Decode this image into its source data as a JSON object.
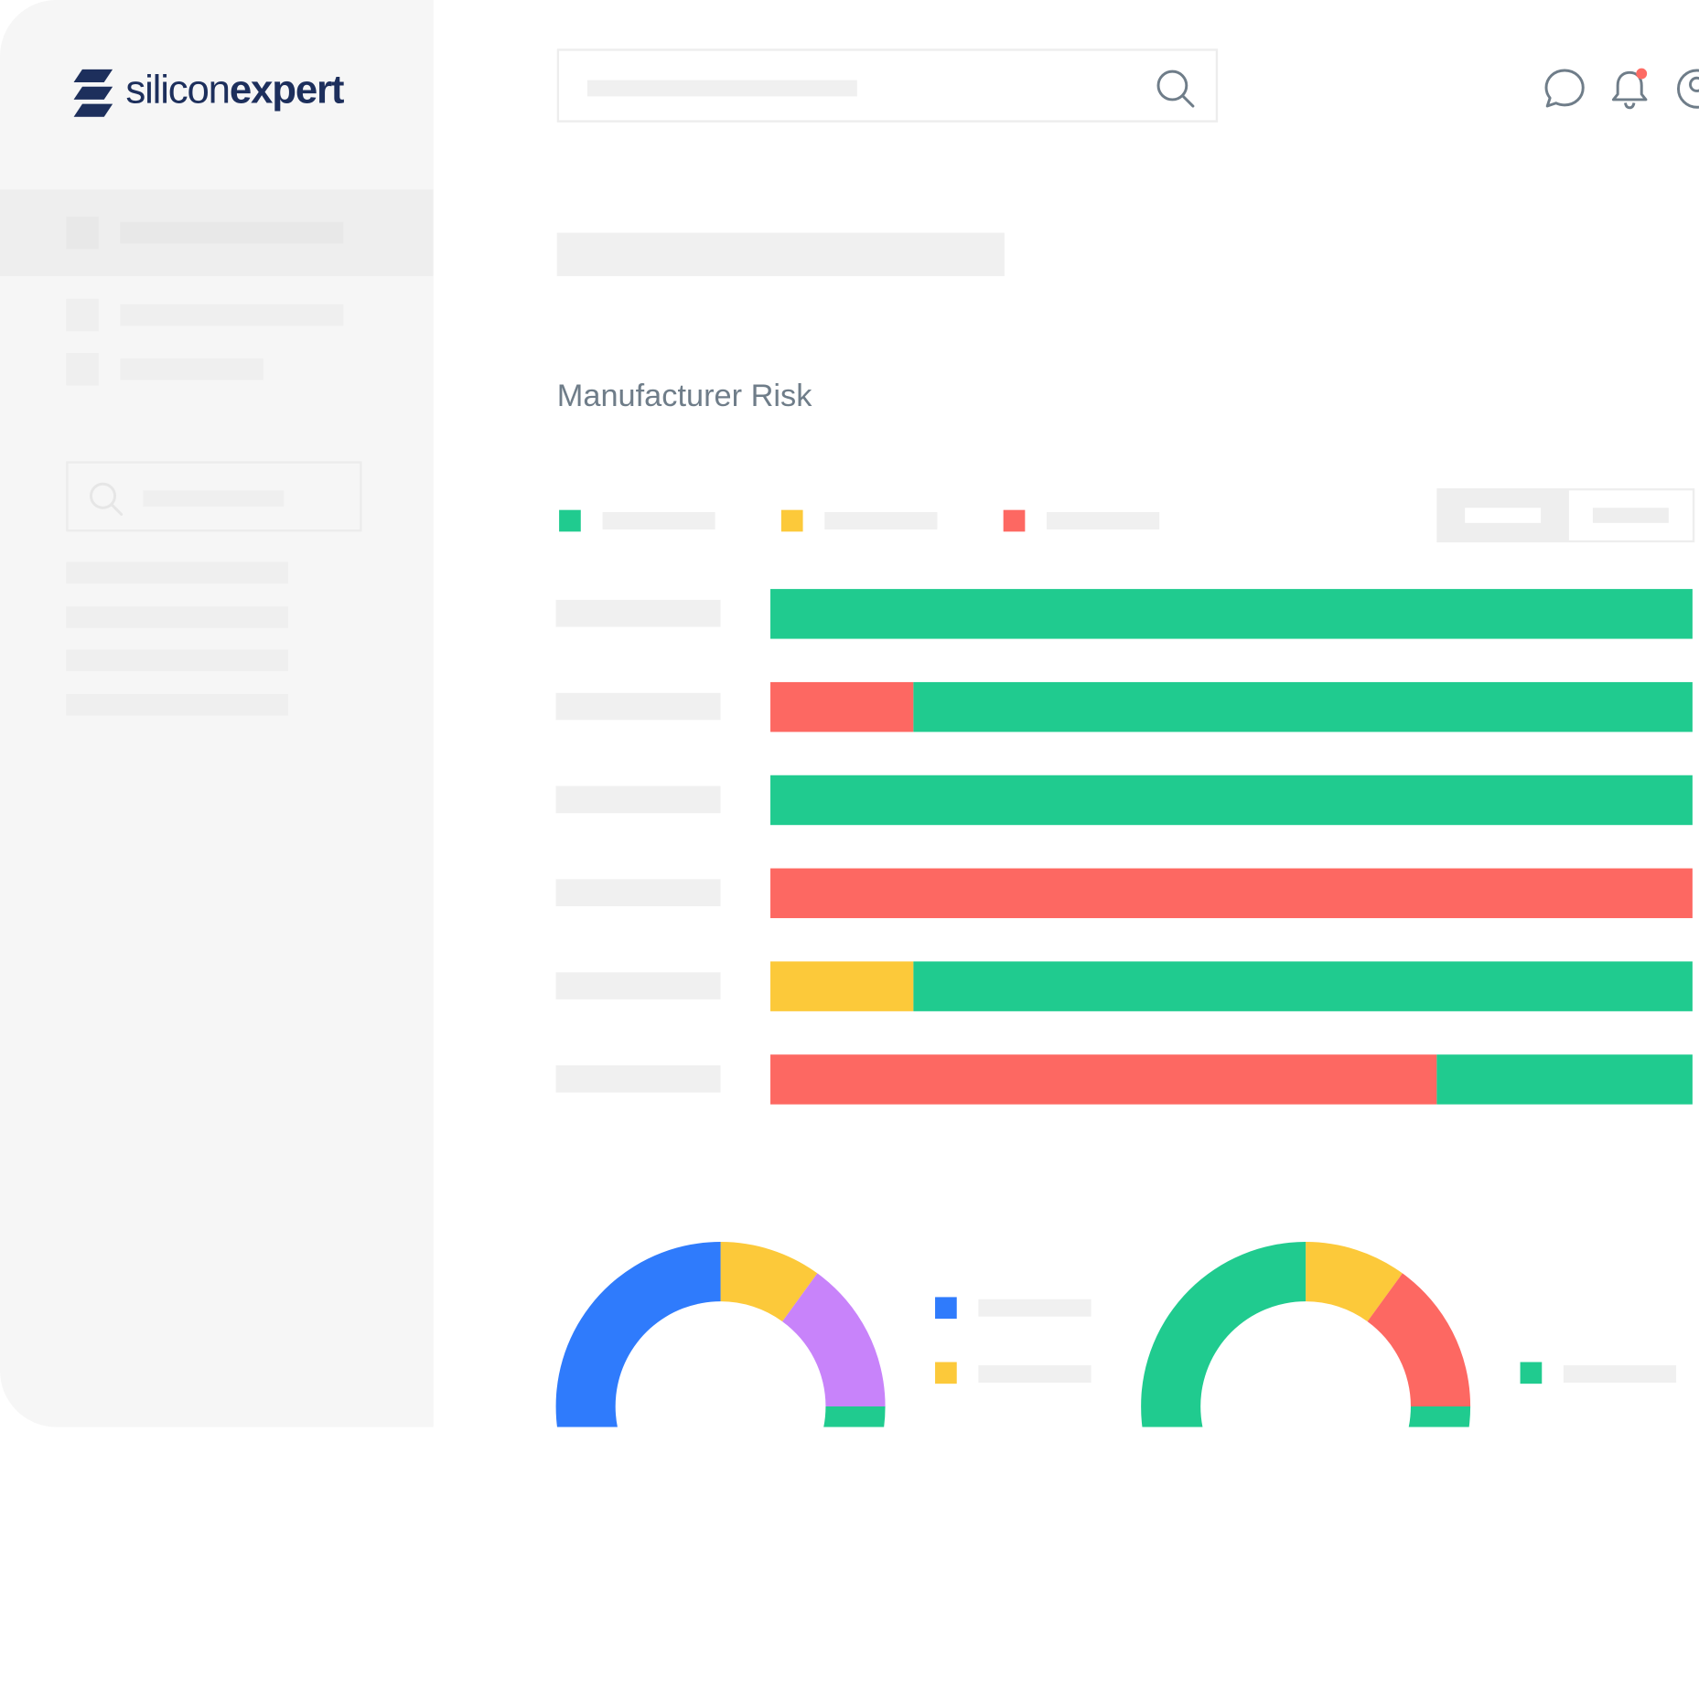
{
  "app": {
    "logo_text_light": "silicon",
    "logo_text_bold": "expert"
  },
  "header": {
    "icons": [
      "search-icon",
      "chat-icon",
      "bell-icon",
      "user-icon"
    ],
    "notification_dot_color": "#fd6b64"
  },
  "main": {
    "section_title": "Manufacturer Risk"
  },
  "colors": {
    "green": "#20cb8f",
    "yellow": "#fcc93a",
    "red": "#fd6862",
    "blue": "#2f7bfc",
    "purple": "#c883fa"
  },
  "chart_data": [
    {
      "type": "bar",
      "title": "Manufacturer Risk",
      "stacked": true,
      "orientation": "horizontal",
      "legend_colors": [
        "#20cb8f",
        "#fcc93a",
        "#fd6862"
      ],
      "rows": [
        {
          "segments": [
            {
              "color": "#20cb8f",
              "value": 1.0
            }
          ]
        },
        {
          "segments": [
            {
              "color": "#fd6862",
              "value": 0.155
            },
            {
              "color": "#20cb8f",
              "value": 0.845
            }
          ]
        },
        {
          "segments": [
            {
              "color": "#20cb8f",
              "value": 1.0
            }
          ]
        },
        {
          "segments": [
            {
              "color": "#fd6862",
              "value": 1.0
            }
          ]
        },
        {
          "segments": [
            {
              "color": "#fcc93a",
              "value": 0.155
            },
            {
              "color": "#20cb8f",
              "value": 0.845
            }
          ]
        },
        {
          "segments": [
            {
              "color": "#fd6862",
              "value": 0.723
            },
            {
              "color": "#20cb8f",
              "value": 0.277
            }
          ]
        }
      ]
    },
    {
      "type": "pie",
      "donut": true,
      "slices": [
        {
          "color": "#fcc93a",
          "value": 0.1
        },
        {
          "color": "#c883fa",
          "value": 0.15
        },
        {
          "color": "#20cb8f",
          "value": 0.05
        },
        {
          "color": "#2f7bfc",
          "value": 0.7
        }
      ],
      "legend_colors": [
        "#2f7bfc",
        "#fcc93a"
      ]
    },
    {
      "type": "pie",
      "donut": true,
      "slices": [
        {
          "color": "#fcc93a",
          "value": 0.1
        },
        {
          "color": "#fd6862",
          "value": 0.15
        },
        {
          "color": "#20cb8f",
          "value": 0.75
        }
      ],
      "legend_colors": [
        "#20cb8f"
      ]
    }
  ]
}
